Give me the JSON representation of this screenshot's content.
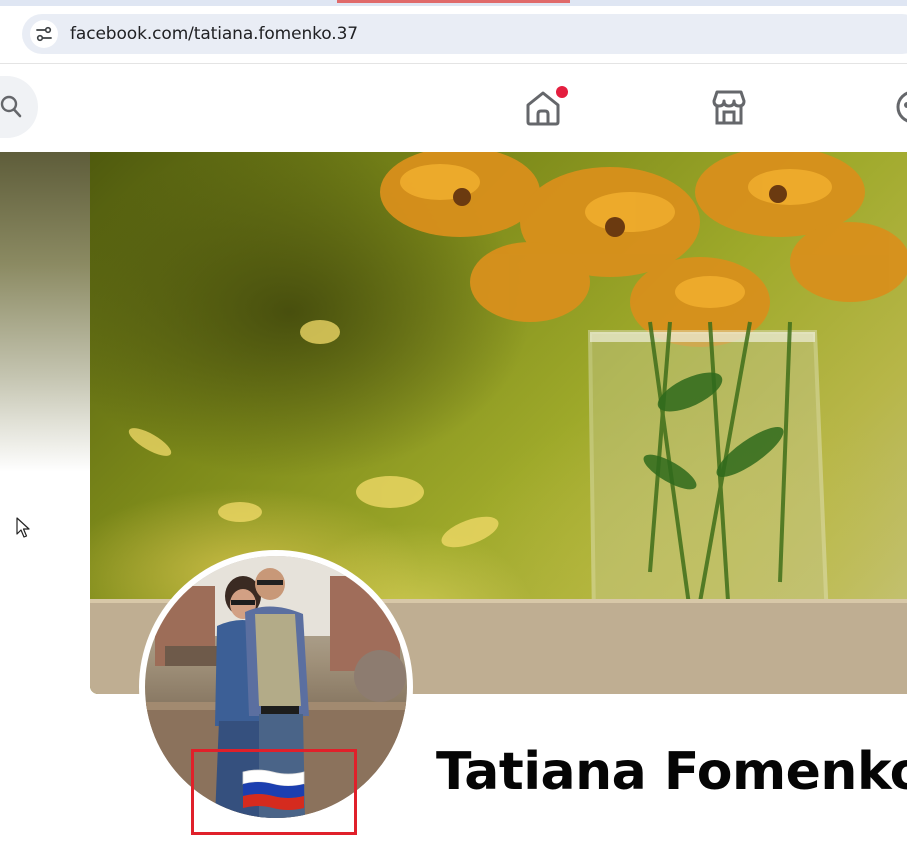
{
  "browser": {
    "url": "facebook.com/tatiana.fomenko.37",
    "site_info_icon": "tune-icon"
  },
  "nav": {
    "search_icon": "search-icon",
    "items": [
      {
        "name": "home",
        "icon": "home-icon",
        "has_notification": true
      },
      {
        "name": "marketplace",
        "icon": "marketplace-icon",
        "has_notification": false
      },
      {
        "name": "groups",
        "icon": "groups-icon",
        "has_notification": false
      }
    ]
  },
  "profile": {
    "name": "Tatiana Fomenko",
    "avatar_badge": "russian-flag"
  },
  "colors": {
    "notification_dot": "#e41e3f",
    "highlight_box": "#e0202a",
    "flag_white": "#ffffff",
    "flag_blue": "#1c3fb0",
    "flag_red": "#d52b1e"
  }
}
